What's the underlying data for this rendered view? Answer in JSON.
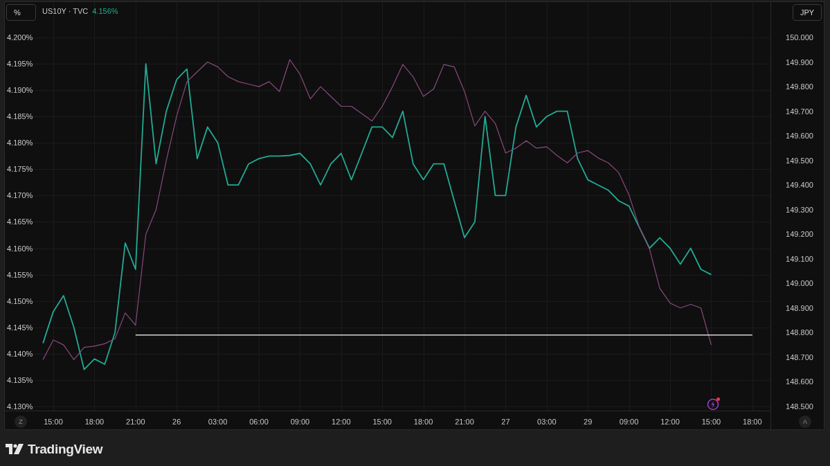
{
  "legend": {
    "symbol": "US10Y · TVC",
    "value": "4.156%"
  },
  "scale_buttons": {
    "left": "%",
    "right": "JPY",
    "auto": "A",
    "zoom": "Z"
  },
  "chart": {
    "chart_data": {
      "type": "line",
      "grid": true,
      "ylim": [
        4.1292,
        4.2067
      ],
      "y2lim": [
        148.483,
        150.1435
      ],
      "categories": [
        null,
        "15:00",
        null,
        null,
        null,
        "18:00",
        null,
        null,
        null,
        "21:00",
        null,
        null,
        null,
        "26",
        null,
        null,
        null,
        "03:00",
        null,
        null,
        null,
        "06:00",
        null,
        null,
        null,
        "09:00",
        null,
        null,
        null,
        "12:00",
        null,
        null,
        null,
        "15:00",
        null,
        null,
        null,
        "18:00",
        null,
        null,
        null,
        "21:00",
        null,
        null,
        null,
        "27",
        null,
        null,
        null,
        "03:00",
        null,
        null,
        null,
        "29",
        null,
        null,
        null,
        "09:00",
        null,
        null,
        null,
        "12:00",
        null,
        null,
        null,
        "15:00",
        null,
        null,
        null,
        "18:00",
        null
      ],
      "yticks": [
        {
          "value": 4.2,
          "label": "4.200%"
        },
        {
          "value": 4.195,
          "label": "4.195%"
        },
        {
          "value": 4.19,
          "label": "4.190%"
        },
        {
          "value": 4.185,
          "label": "4.185%"
        },
        {
          "value": 4.18,
          "label": "4.180%"
        },
        {
          "value": 4.175,
          "label": "4.175%"
        },
        {
          "value": 4.17,
          "label": "4.170%"
        },
        {
          "value": 4.165,
          "label": "4.165%"
        },
        {
          "value": 4.16,
          "label": "4.160%"
        },
        {
          "value": 4.155,
          "label": "4.155%"
        },
        {
          "value": 4.15,
          "label": "4.150%"
        },
        {
          "value": 4.145,
          "label": "4.145%"
        },
        {
          "value": 4.14,
          "label": "4.140%"
        },
        {
          "value": 4.135,
          "label": "4.135%"
        },
        {
          "value": 4.13,
          "label": "4.130%"
        }
      ],
      "y2ticks": [
        {
          "value": 150,
          "label": "150.000"
        },
        {
          "value": 149.9,
          "label": "149.900"
        },
        {
          "value": 149.8,
          "label": "149.800"
        },
        {
          "value": 149.7,
          "label": "149.700"
        },
        {
          "value": 149.6,
          "label": "149.600"
        },
        {
          "value": 149.5,
          "label": "149.500"
        },
        {
          "value": 149.4,
          "label": "149.400"
        },
        {
          "value": 149.3,
          "label": "149.300"
        },
        {
          "value": 149.2,
          "label": "149.200"
        },
        {
          "value": 149.1,
          "label": "149.100"
        },
        {
          "value": 149,
          "label": "149.000"
        },
        {
          "value": 148.9,
          "label": "148.900"
        },
        {
          "value": 148.8,
          "label": "148.800"
        },
        {
          "value": 148.7,
          "label": "148.700"
        },
        {
          "value": 148.6,
          "label": "148.600"
        },
        {
          "value": 148.5,
          "label": "148.500"
        }
      ],
      "series": [
        {
          "color": "#22ab94",
          "values": [
            4.142,
            4.148,
            4.151,
            4.145,
            4.137,
            4.139,
            4.138,
            4.144,
            4.161,
            4.156,
            4.195,
            4.176,
            4.186,
            4.192,
            4.194,
            4.177,
            4.183,
            4.18,
            4.172,
            4.172,
            4.176,
            4.177,
            4.1775,
            4.1775,
            4.1776,
            4.178,
            4.176,
            4.172,
            4.176,
            4.178,
            4.173,
            4.178,
            4.183,
            4.183,
            4.181,
            4.186,
            4.176,
            4.173,
            4.176,
            4.176,
            4.169,
            4.162,
            4.165,
            4.185,
            4.17,
            4.17,
            4.183,
            4.189,
            4.183,
            4.185,
            4.186,
            4.186,
            4.177,
            4.173,
            4.172,
            4.171,
            4.169,
            4.168,
            4.164,
            4.16,
            4.162,
            4.16,
            4.157,
            4.16,
            4.156,
            4.155,
            null,
            null,
            null,
            null,
            null
          ]
        },
        {
          "color": "#8a4a7e",
          "axis": "y2",
          "values": [
            148.69,
            148.77,
            148.75,
            148.69,
            148.74,
            148.745,
            148.755,
            148.775,
            148.88,
            148.83,
            149.2,
            149.3,
            149.5,
            149.68,
            149.82,
            149.86,
            149.9,
            149.88,
            149.84,
            149.82,
            149.81,
            149.8,
            149.82,
            149.78,
            149.91,
            149.85,
            149.75,
            149.8,
            149.76,
            149.72,
            149.72,
            149.69,
            149.66,
            149.72,
            149.8,
            149.89,
            149.84,
            149.76,
            149.79,
            149.89,
            149.88,
            149.78,
            149.64,
            149.7,
            149.65,
            149.53,
            149.55,
            149.58,
            149.55,
            149.555,
            149.52,
            149.49,
            149.53,
            149.54,
            149.51,
            149.49,
            149.45,
            149.36,
            149.23,
            149.14,
            148.98,
            148.92,
            148.9,
            148.915,
            148.9,
            148.75,
            null,
            null,
            null,
            null,
            null
          ]
        },
        {
          "color": "#ffffff",
          "axis": "y2",
          "values": [
            null,
            null,
            null,
            null,
            null,
            null,
            null,
            null,
            null,
            148.79,
            148.79,
            148.79,
            148.79,
            148.79,
            148.79,
            148.79,
            148.79,
            148.79,
            148.79,
            148.79,
            148.79,
            148.79,
            148.79,
            148.79,
            148.79,
            148.79,
            148.79,
            148.79,
            148.79,
            148.79,
            148.79,
            148.79,
            148.79,
            148.79,
            148.79,
            148.79,
            148.79,
            148.79,
            148.79,
            148.79,
            148.79,
            148.79,
            148.79,
            148.79,
            148.79,
            148.79,
            148.79,
            148.79,
            148.79,
            148.79,
            148.79,
            148.79,
            148.79,
            148.79,
            148.79,
            148.79,
            148.79,
            148.79,
            148.79,
            148.79,
            148.79,
            148.79,
            148.79,
            148.79,
            148.79,
            148.79,
            148.79,
            148.79,
            148.79,
            148.79,
            null
          ]
        }
      ]
    }
  },
  "alert_badge": {
    "unread": true
  },
  "footer": {
    "brand": "TradingView"
  }
}
